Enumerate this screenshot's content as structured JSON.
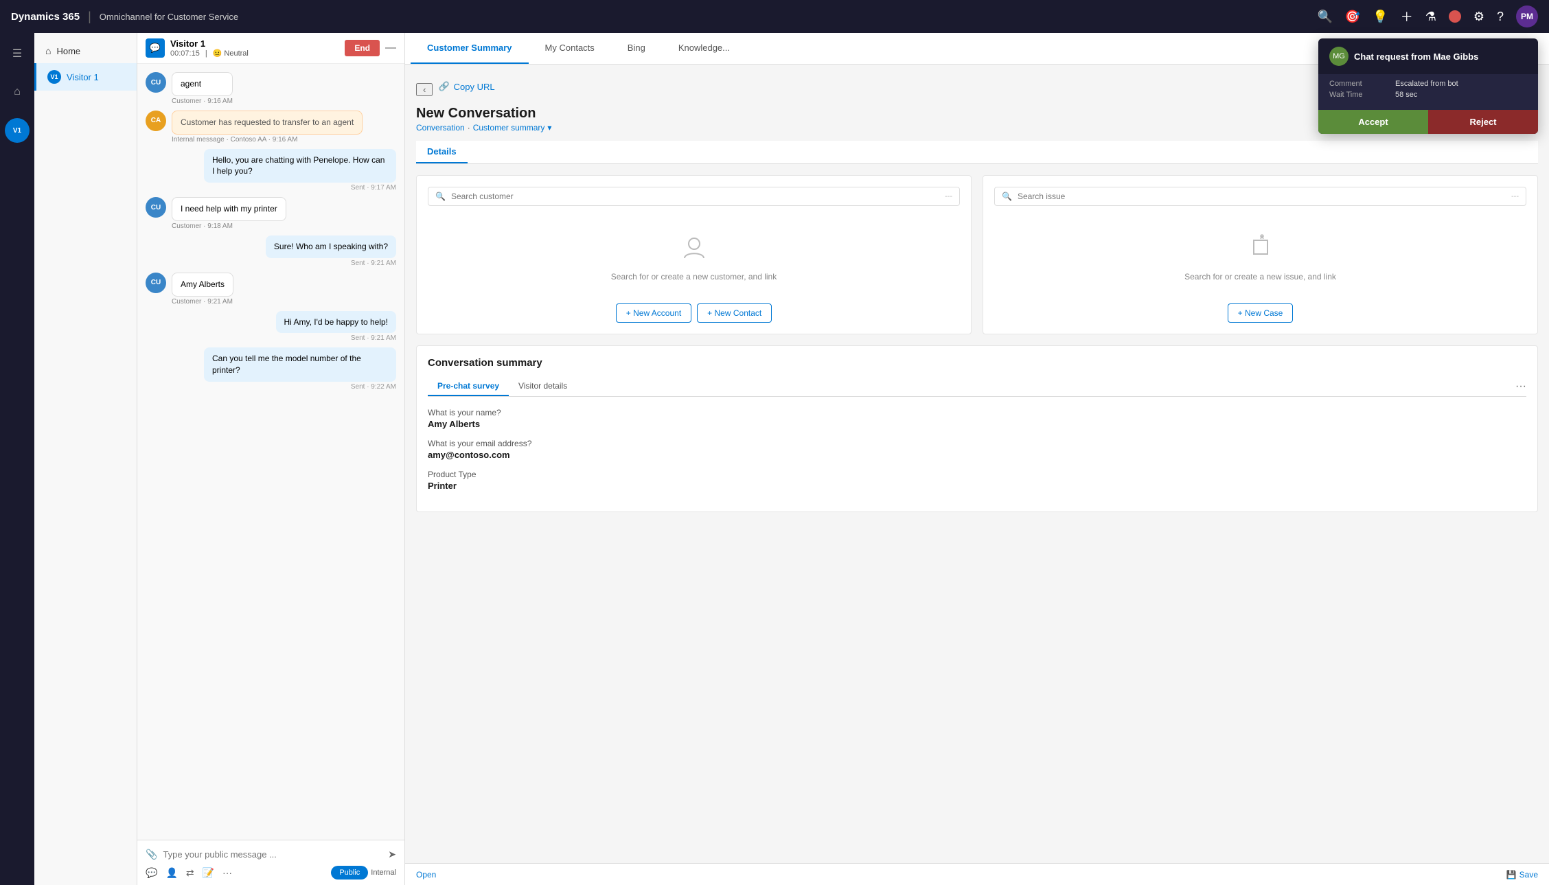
{
  "app": {
    "brand": "Dynamics 365",
    "module": "Omnichannel for Customer Service"
  },
  "topnav": {
    "avatar_initials": "PM",
    "icons": [
      "search",
      "target",
      "lightbulb",
      "plus",
      "filter",
      "settings",
      "help"
    ]
  },
  "sidebar_nav": {
    "items": [
      {
        "id": "hamburger",
        "icon": "☰",
        "label": "Menu"
      },
      {
        "id": "home",
        "icon": "⌂",
        "label": "Home"
      },
      {
        "id": "visitor1",
        "icon": "V1",
        "label": "Visitor 1"
      }
    ]
  },
  "chat": {
    "visitor_name": "Visitor 1",
    "session_time": "00:07:15",
    "sentiment": "Neutral",
    "end_button": "End",
    "messages": [
      {
        "id": 1,
        "role": "agent",
        "avatar": "CU",
        "avatar_color": "cu",
        "text": "agent",
        "time": "Customer · 9:16 AM",
        "align": "left"
      },
      {
        "id": 2,
        "role": "system",
        "avatar": "CA",
        "avatar_color": "ca",
        "text": "Customer has requested to transfer to an agent",
        "time": "Internal message · Contoso AA · 9:16 AM",
        "align": "left",
        "type": "transfer"
      },
      {
        "id": 3,
        "role": "agent",
        "avatar": null,
        "text": "Hello, you are chatting with Penelope. How can I help you?",
        "time": "Sent · 9:17 AM",
        "align": "right",
        "type": "agent"
      },
      {
        "id": 4,
        "role": "customer",
        "avatar": "CU",
        "avatar_color": "cu",
        "text": "I need help with my printer",
        "time": "Customer · 9:18 AM",
        "align": "left"
      },
      {
        "id": 5,
        "role": "agent",
        "avatar": null,
        "text": "Sure! Who am I speaking with?",
        "time": "Sent · 9:21 AM",
        "align": "right",
        "type": "agent"
      },
      {
        "id": 6,
        "role": "customer",
        "avatar": "CU",
        "avatar_color": "cu",
        "text": "Amy Alberts",
        "time": "Customer · 9:21 AM",
        "align": "left"
      },
      {
        "id": 7,
        "role": "agent",
        "avatar": null,
        "text": "Hi Amy, I'd be happy to help!",
        "time": "Sent · 9:21 AM",
        "align": "right",
        "type": "agent"
      },
      {
        "id": 8,
        "role": "agent",
        "avatar": null,
        "text": "Can you tell me the model number of the printer?",
        "time": "Sent · 9:22 AM",
        "align": "right",
        "type": "agent"
      }
    ],
    "input_placeholder": "Type your public message ...",
    "public_label": "Public",
    "internal_label": "Internal"
  },
  "tabs": [
    {
      "id": "customer-summary",
      "label": "Customer Summary",
      "active": true
    },
    {
      "id": "my-contacts",
      "label": "My Contacts",
      "active": false
    },
    {
      "id": "bing",
      "label": "Bing",
      "active": false
    },
    {
      "id": "knowledge",
      "label": "Knowledge...",
      "active": false
    }
  ],
  "content": {
    "copy_url_label": "Copy URL",
    "title": "New Conversation",
    "breadcrumb_part1": "Conversation",
    "breadcrumb_separator": "·",
    "breadcrumb_part2": "Customer summary",
    "breadcrumb_dropdown": "▾",
    "active_tab": "Details",
    "customer_search": {
      "placeholder": "Search customer",
      "dots": "---",
      "empty_text": "Search for or create a new customer, and link",
      "new_account_btn": "+ New Account",
      "new_contact_btn": "+ New Contact"
    },
    "issue_search": {
      "placeholder": "Search issue",
      "dots": "---",
      "empty_text": "Search for or create a new issue, and link",
      "new_case_btn": "+ New Case"
    },
    "conversation_summary": {
      "title": "Conversation summary",
      "tabs": [
        {
          "id": "pre-chat-survey",
          "label": "Pre-chat survey",
          "active": true
        },
        {
          "id": "visitor-details",
          "label": "Visitor details",
          "active": false
        }
      ],
      "fields": [
        {
          "label": "What is your name?",
          "value": "Amy Alberts"
        },
        {
          "label": "What is your email address?",
          "value": "amy@contoso.com"
        },
        {
          "label": "Product Type",
          "value": "Printer"
        }
      ]
    }
  },
  "notification": {
    "avatar_initials": "MG",
    "title": "Chat request from Mae Gibbs",
    "comment_label": "Comment",
    "comment_value": "Escalated from bot",
    "wait_time_label": "Wait Time",
    "wait_time_value": "58 sec",
    "accept_label": "Accept",
    "reject_label": "Reject"
  },
  "bottom_bar": {
    "open_label": "Open",
    "save_label": "Save"
  }
}
